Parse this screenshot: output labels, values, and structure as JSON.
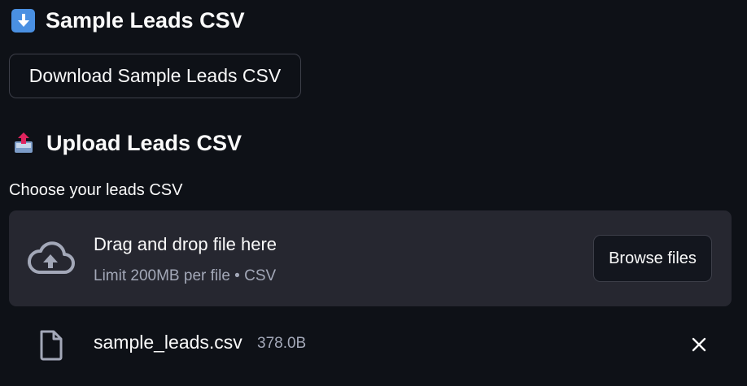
{
  "sample_section": {
    "heading": "Sample Leads CSV",
    "heading_icon": "down-arrow-emoji-icon",
    "download_button_label": "Download Sample Leads CSV"
  },
  "upload_section": {
    "heading": "Upload Leads CSV",
    "heading_icon": "outbox-tray-emoji-icon",
    "field_label": "Choose your leads CSV",
    "dropzone": {
      "icon": "cloud-upload-icon",
      "title": "Drag and drop file here",
      "subtitle": "Limit 200MB per file • CSV",
      "browse_button_label": "Browse files"
    },
    "uploaded_file": {
      "icon": "file-icon",
      "name": "sample_leads.csv",
      "size": "378.0B",
      "remove_icon": "close-icon"
    }
  },
  "colors": {
    "background": "#0e1117",
    "surface": "#262730",
    "text": "#fafafa",
    "muted_text": "#a3a8b8",
    "border": "#3d3f49"
  }
}
